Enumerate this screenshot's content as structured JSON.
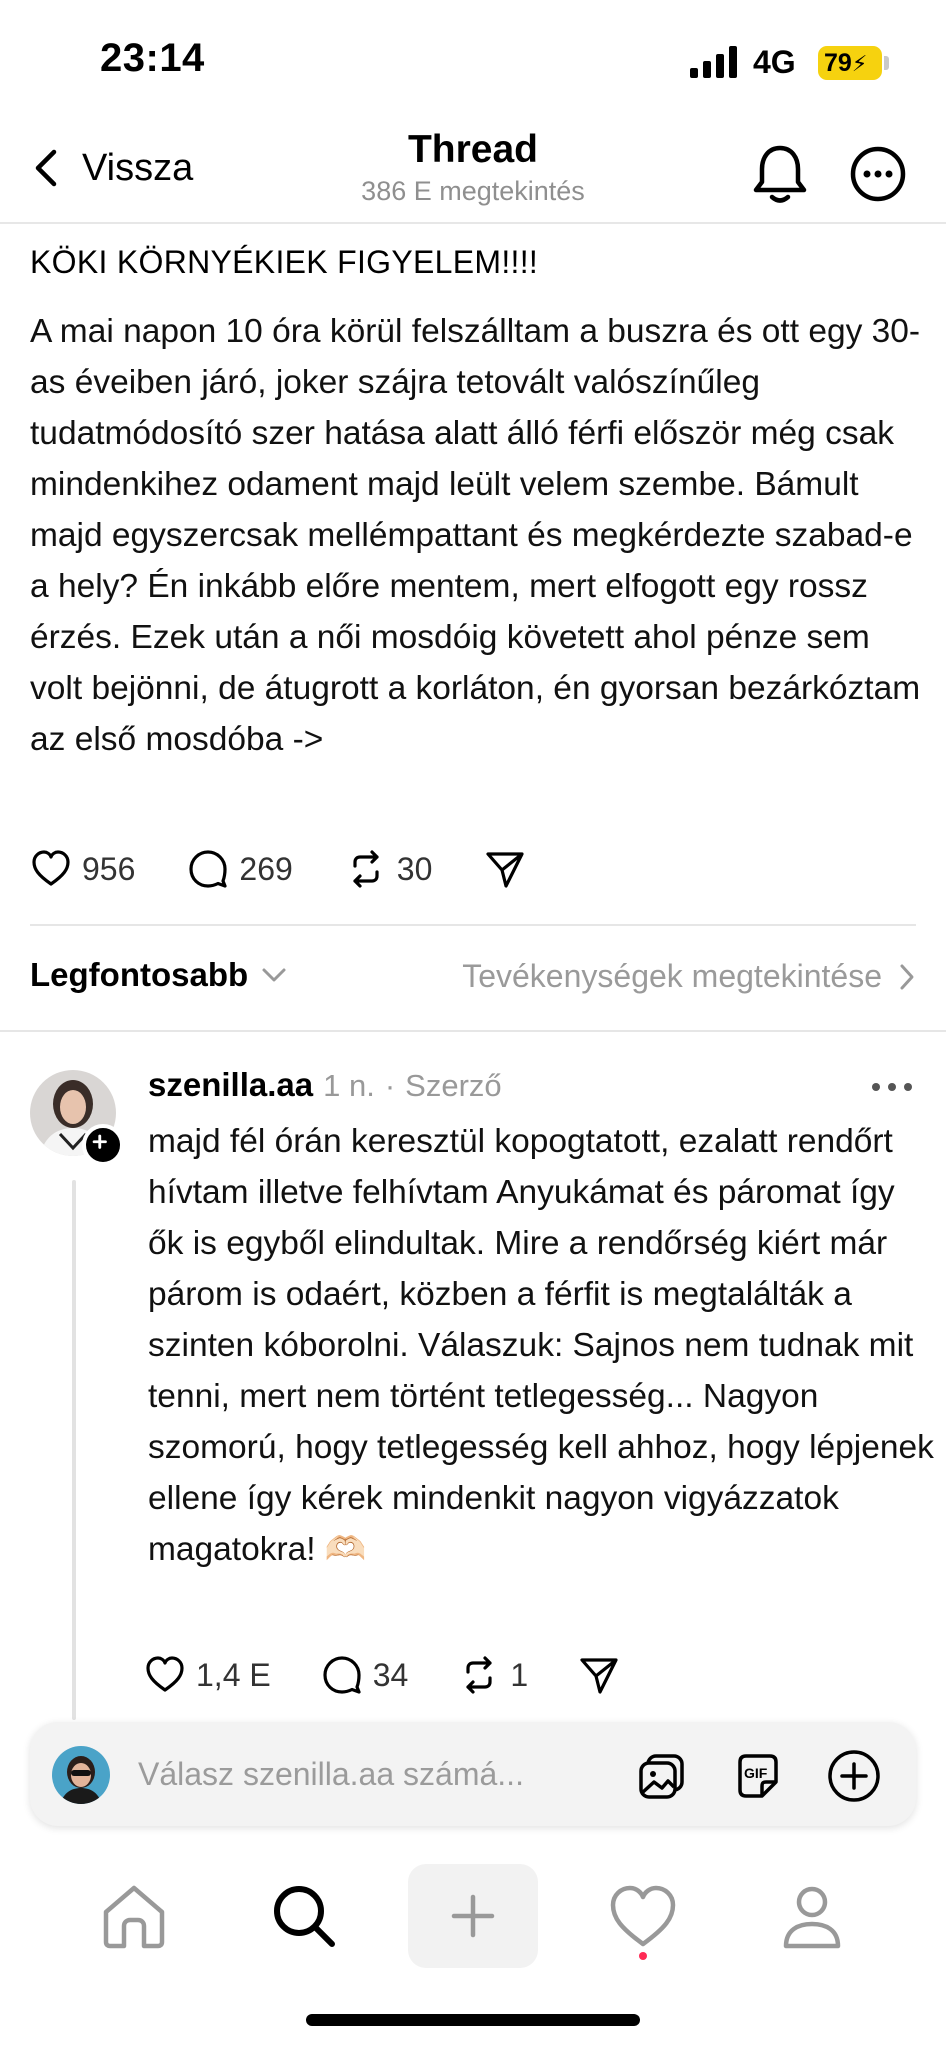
{
  "status_bar": {
    "time": "23:14",
    "network": "4G",
    "battery": "79"
  },
  "header": {
    "back_label": "Vissza",
    "title": "Thread",
    "subtitle": "386 E megtekintés"
  },
  "post": {
    "headline": "KÖKI KÖRNYÉKIEK FIGYELEM!!!!",
    "body": "A mai napon 10 óra körül felszálltam a buszra és ott egy 30-as éveiben járó, joker szájra tetovált valószínűleg tudatmódosító szer hatása alatt álló férfi először még csak mindenkihez odament majd leült velem szembe. Bámult majd egyszercsak mellémpattant és megkérdezte szabad-e a hely? Én inkább előre mentem, mert elfogott egy rossz érzés. Ezek után a női mosdóig követett ahol pénze sem volt bejönni, de átugrott a korláton, én gyorsan bezárkóztam az első mosdóba ->",
    "likes": "956",
    "comments": "269",
    "reposts": "30"
  },
  "sort": {
    "label": "Legfontosabb",
    "activity_link": "Tevékenységek megtekintése"
  },
  "reply": {
    "username": "szenilla.aa",
    "time": "1 n.",
    "separator": "·",
    "role": "Szerző",
    "body": "majd fél órán keresztül kopogtatott, ezalatt rendőrt hívtam illetve felhívtam Anyukámat és páromat így ők is egyből elindultak. Mire a rendőrség kiért már párom is odaért, közben a férfit is megtalálták a szinten kóborolni. Válaszuk: Sajnos nem tudnak mit tenni, mert nem történt tetlegesség... Nagyon szomorú, hogy tetlegesség kell ahhoz, hogy lépjenek ellene így kérek mindenkit nagyon vigyázzatok magatokra! 🫶🏻",
    "likes": "1,4 E",
    "comments": "34",
    "reposts": "1"
  },
  "composer": {
    "placeholder": "Válasz szenilla.aa számá..."
  },
  "colors": {
    "battery": "#f6d20f",
    "notification_dot": "#ff2a55",
    "muted_text": "#8f8f8f"
  },
  "icons": [
    "signal-icon",
    "back-chevron-icon",
    "bell-icon",
    "more-icon",
    "heart-icon",
    "comment-icon",
    "repost-icon",
    "share-icon",
    "chevron-down-icon",
    "chevron-right-icon",
    "plus-icon",
    "image-icon",
    "gif-icon",
    "home-icon",
    "search-icon",
    "new-post-icon",
    "activity-icon",
    "profile-icon"
  ]
}
